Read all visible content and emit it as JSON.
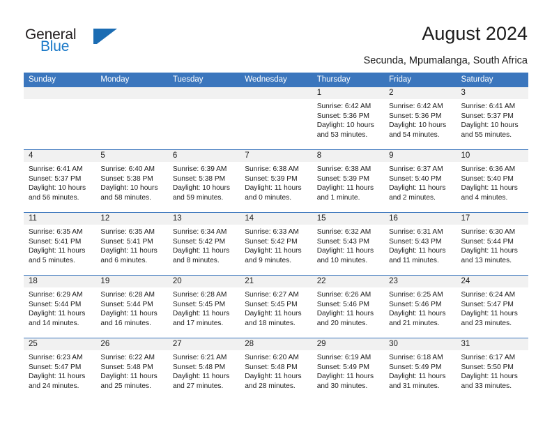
{
  "brand": {
    "name_top": "General",
    "name_bottom": "Blue",
    "mark": "triangle-flag-logo",
    "color": "#1b6cb3"
  },
  "header": {
    "title": "August 2024",
    "subtitle": "Secunda, Mpumalanga, South Africa"
  },
  "theme": {
    "header_blue": "#3b76bd",
    "day_band_gray": "#f1f1f1",
    "text": "#1a1a1a"
  },
  "calendar": {
    "weekdays": [
      "Sunday",
      "Monday",
      "Tuesday",
      "Wednesday",
      "Thursday",
      "Friday",
      "Saturday"
    ],
    "weeks": [
      [
        {
          "day": "",
          "lines": []
        },
        {
          "day": "",
          "lines": []
        },
        {
          "day": "",
          "lines": []
        },
        {
          "day": "",
          "lines": []
        },
        {
          "day": "1",
          "lines": [
            "Sunrise: 6:42 AM",
            "Sunset: 5:36 PM",
            "Daylight: 10 hours",
            "and 53 minutes."
          ]
        },
        {
          "day": "2",
          "lines": [
            "Sunrise: 6:42 AM",
            "Sunset: 5:36 PM",
            "Daylight: 10 hours",
            "and 54 minutes."
          ]
        },
        {
          "day": "3",
          "lines": [
            "Sunrise: 6:41 AM",
            "Sunset: 5:37 PM",
            "Daylight: 10 hours",
            "and 55 minutes."
          ]
        }
      ],
      [
        {
          "day": "4",
          "lines": [
            "Sunrise: 6:41 AM",
            "Sunset: 5:37 PM",
            "Daylight: 10 hours",
            "and 56 minutes."
          ]
        },
        {
          "day": "5",
          "lines": [
            "Sunrise: 6:40 AM",
            "Sunset: 5:38 PM",
            "Daylight: 10 hours",
            "and 58 minutes."
          ]
        },
        {
          "day": "6",
          "lines": [
            "Sunrise: 6:39 AM",
            "Sunset: 5:38 PM",
            "Daylight: 10 hours",
            "and 59 minutes."
          ]
        },
        {
          "day": "7",
          "lines": [
            "Sunrise: 6:38 AM",
            "Sunset: 5:39 PM",
            "Daylight: 11 hours",
            "and 0 minutes."
          ]
        },
        {
          "day": "8",
          "lines": [
            "Sunrise: 6:38 AM",
            "Sunset: 5:39 PM",
            "Daylight: 11 hours",
            "and 1 minute."
          ]
        },
        {
          "day": "9",
          "lines": [
            "Sunrise: 6:37 AM",
            "Sunset: 5:40 PM",
            "Daylight: 11 hours",
            "and 2 minutes."
          ]
        },
        {
          "day": "10",
          "lines": [
            "Sunrise: 6:36 AM",
            "Sunset: 5:40 PM",
            "Daylight: 11 hours",
            "and 4 minutes."
          ]
        }
      ],
      [
        {
          "day": "11",
          "lines": [
            "Sunrise: 6:35 AM",
            "Sunset: 5:41 PM",
            "Daylight: 11 hours",
            "and 5 minutes."
          ]
        },
        {
          "day": "12",
          "lines": [
            "Sunrise: 6:35 AM",
            "Sunset: 5:41 PM",
            "Daylight: 11 hours",
            "and 6 minutes."
          ]
        },
        {
          "day": "13",
          "lines": [
            "Sunrise: 6:34 AM",
            "Sunset: 5:42 PM",
            "Daylight: 11 hours",
            "and 8 minutes."
          ]
        },
        {
          "day": "14",
          "lines": [
            "Sunrise: 6:33 AM",
            "Sunset: 5:42 PM",
            "Daylight: 11 hours",
            "and 9 minutes."
          ]
        },
        {
          "day": "15",
          "lines": [
            "Sunrise: 6:32 AM",
            "Sunset: 5:43 PM",
            "Daylight: 11 hours",
            "and 10 minutes."
          ]
        },
        {
          "day": "16",
          "lines": [
            "Sunrise: 6:31 AM",
            "Sunset: 5:43 PM",
            "Daylight: 11 hours",
            "and 11 minutes."
          ]
        },
        {
          "day": "17",
          "lines": [
            "Sunrise: 6:30 AM",
            "Sunset: 5:44 PM",
            "Daylight: 11 hours",
            "and 13 minutes."
          ]
        }
      ],
      [
        {
          "day": "18",
          "lines": [
            "Sunrise: 6:29 AM",
            "Sunset: 5:44 PM",
            "Daylight: 11 hours",
            "and 14 minutes."
          ]
        },
        {
          "day": "19",
          "lines": [
            "Sunrise: 6:28 AM",
            "Sunset: 5:44 PM",
            "Daylight: 11 hours",
            "and 16 minutes."
          ]
        },
        {
          "day": "20",
          "lines": [
            "Sunrise: 6:28 AM",
            "Sunset: 5:45 PM",
            "Daylight: 11 hours",
            "and 17 minutes."
          ]
        },
        {
          "day": "21",
          "lines": [
            "Sunrise: 6:27 AM",
            "Sunset: 5:45 PM",
            "Daylight: 11 hours",
            "and 18 minutes."
          ]
        },
        {
          "day": "22",
          "lines": [
            "Sunrise: 6:26 AM",
            "Sunset: 5:46 PM",
            "Daylight: 11 hours",
            "and 20 minutes."
          ]
        },
        {
          "day": "23",
          "lines": [
            "Sunrise: 6:25 AM",
            "Sunset: 5:46 PM",
            "Daylight: 11 hours",
            "and 21 minutes."
          ]
        },
        {
          "day": "24",
          "lines": [
            "Sunrise: 6:24 AM",
            "Sunset: 5:47 PM",
            "Daylight: 11 hours",
            "and 23 minutes."
          ]
        }
      ],
      [
        {
          "day": "25",
          "lines": [
            "Sunrise: 6:23 AM",
            "Sunset: 5:47 PM",
            "Daylight: 11 hours",
            "and 24 minutes."
          ]
        },
        {
          "day": "26",
          "lines": [
            "Sunrise: 6:22 AM",
            "Sunset: 5:48 PM",
            "Daylight: 11 hours",
            "and 25 minutes."
          ]
        },
        {
          "day": "27",
          "lines": [
            "Sunrise: 6:21 AM",
            "Sunset: 5:48 PM",
            "Daylight: 11 hours",
            "and 27 minutes."
          ]
        },
        {
          "day": "28",
          "lines": [
            "Sunrise: 6:20 AM",
            "Sunset: 5:48 PM",
            "Daylight: 11 hours",
            "and 28 minutes."
          ]
        },
        {
          "day": "29",
          "lines": [
            "Sunrise: 6:19 AM",
            "Sunset: 5:49 PM",
            "Daylight: 11 hours",
            "and 30 minutes."
          ]
        },
        {
          "day": "30",
          "lines": [
            "Sunrise: 6:18 AM",
            "Sunset: 5:49 PM",
            "Daylight: 11 hours",
            "and 31 minutes."
          ]
        },
        {
          "day": "31",
          "lines": [
            "Sunrise: 6:17 AM",
            "Sunset: 5:50 PM",
            "Daylight: 11 hours",
            "and 33 minutes."
          ]
        }
      ]
    ]
  }
}
